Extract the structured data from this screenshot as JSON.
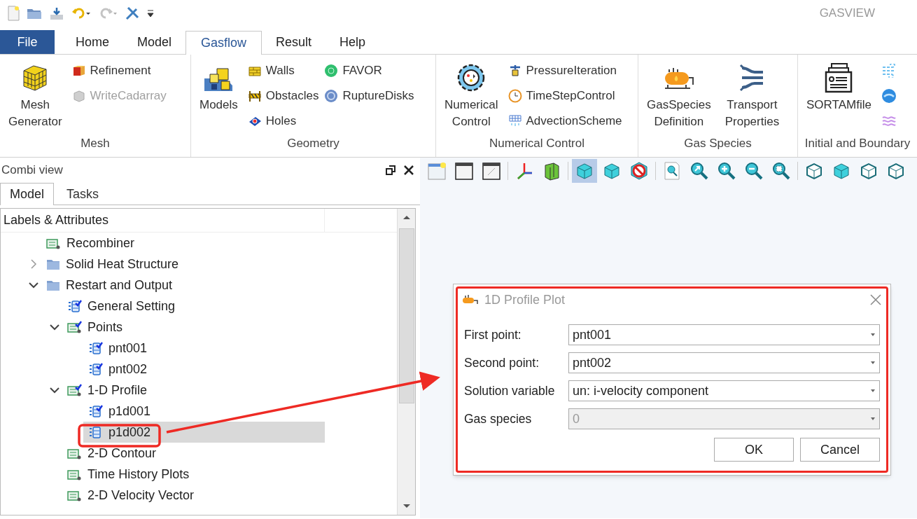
{
  "app_title": "GASVIEW",
  "menu_tabs": [
    {
      "label": "File",
      "kind": "file",
      "selected": false
    },
    {
      "label": "Home",
      "kind": "tab",
      "selected": false
    },
    {
      "label": "Model",
      "kind": "tab",
      "selected": false
    },
    {
      "label": "Gasflow",
      "kind": "tab",
      "selected": true
    },
    {
      "label": "Result",
      "kind": "tab",
      "selected": false
    },
    {
      "label": "Help",
      "kind": "tab",
      "selected": false
    }
  ],
  "ribbon_groups": [
    {
      "label": "Mesh",
      "items": [
        {
          "kind": "large",
          "label": "Mesh\nGenerator",
          "disabled": false
        },
        {
          "kind": "small",
          "label": "Refinement",
          "disabled": false
        },
        {
          "kind": "small",
          "label": "WriteCadarray",
          "disabled": true
        }
      ]
    },
    {
      "label": "Geometry",
      "items": [
        {
          "kind": "large",
          "label": "Models",
          "disabled": false
        },
        {
          "kind": "small",
          "label": "Walls",
          "disabled": false
        },
        {
          "kind": "small",
          "label": "Obstacles",
          "disabled": false
        },
        {
          "kind": "small",
          "label": "Holes",
          "disabled": false
        },
        {
          "kind": "small",
          "label": "FAVOR",
          "disabled": false
        },
        {
          "kind": "small",
          "label": "RuptureDisks",
          "disabled": false
        }
      ]
    },
    {
      "label": "Numerical Control",
      "items": [
        {
          "kind": "large",
          "label": "Numerical\nControl",
          "disabled": false
        },
        {
          "kind": "small",
          "label": "PressureIteration",
          "disabled": false
        },
        {
          "kind": "small",
          "label": "TimeStepControl",
          "disabled": false
        },
        {
          "kind": "small",
          "label": "AdvectionScheme",
          "disabled": false
        }
      ]
    },
    {
      "label": "Gas Species",
      "items": [
        {
          "kind": "large",
          "label": "GasSpecies\nDefinition",
          "disabled": false
        },
        {
          "kind": "large",
          "label": "Transport\nProperties",
          "disabled": false
        }
      ]
    },
    {
      "label": "Initial and Boundary",
      "items": [
        {
          "kind": "large",
          "label": "SORTAMfile",
          "disabled": false
        },
        {
          "kind": "icon"
        },
        {
          "kind": "icon"
        },
        {
          "kind": "icon"
        }
      ]
    }
  ],
  "panel": {
    "title": "Combi view",
    "tabs": [
      {
        "label": "Model",
        "selected": true
      },
      {
        "label": "Tasks",
        "selected": false
      }
    ],
    "column_1": "Labels & Attributes"
  },
  "tree": [
    {
      "label": "Recombiner",
      "kind": "section",
      "configured": false,
      "selected": false
    },
    {
      "label": "Solid Heat Structure",
      "kind": "folder",
      "expanded": false,
      "selected": false
    },
    {
      "label": "Restart and Output",
      "kind": "folder",
      "expanded": true,
      "selected": false,
      "children": [
        {
          "label": "General Setting",
          "kind": "entry",
          "configured": true,
          "selected": false
        },
        {
          "label": "Points",
          "kind": "section",
          "configured": true,
          "expanded": true,
          "selected": false,
          "children": [
            {
              "label": "pnt001",
              "kind": "entry",
              "configured": true,
              "selected": false
            },
            {
              "label": "pnt002",
              "kind": "entry",
              "configured": true,
              "selected": false
            }
          ]
        },
        {
          "label": "1-D Profile",
          "kind": "section",
          "configured": true,
          "expanded": true,
          "selected": false,
          "children": [
            {
              "label": "p1d001",
              "kind": "entry",
              "configured": true,
              "selected": false
            },
            {
              "label": "p1d002",
              "kind": "entry",
              "configured": false,
              "selected": true
            }
          ]
        },
        {
          "label": "2-D Contour",
          "kind": "section",
          "configured": false,
          "selected": false
        },
        {
          "label": "Time History Plots",
          "kind": "section",
          "configured": false,
          "selected": false
        },
        {
          "label": "2-D Velocity Vector",
          "kind": "section",
          "configured": false,
          "selected": false
        }
      ]
    }
  ],
  "viewer_toolbar": [
    {
      "selected": false
    },
    {
      "selected": false
    },
    {
      "selected": false
    },
    {
      "selected": false
    },
    {
      "selected": false
    },
    {
      "selected": true
    },
    {
      "selected": false
    },
    {
      "selected": false
    },
    {
      "selected": false
    },
    {
      "selected": false
    },
    {
      "selected": false
    },
    {
      "selected": false
    },
    {
      "selected": false
    },
    {
      "selected": false
    },
    {
      "selected": false
    },
    {
      "selected": false
    },
    {
      "selected": false
    }
  ],
  "dialog": {
    "title": "1D Profile Plot",
    "fields": [
      {
        "label": "First point:",
        "value": "pnt001",
        "disabled": false
      },
      {
        "label": "Second point:",
        "value": "pnt002",
        "disabled": false
      },
      {
        "label": "Solution variable",
        "value": "un: i-velocity component",
        "disabled": false
      },
      {
        "label": "Gas species",
        "value": "0",
        "disabled": true
      }
    ],
    "buttons": [
      "OK",
      "Cancel"
    ]
  }
}
